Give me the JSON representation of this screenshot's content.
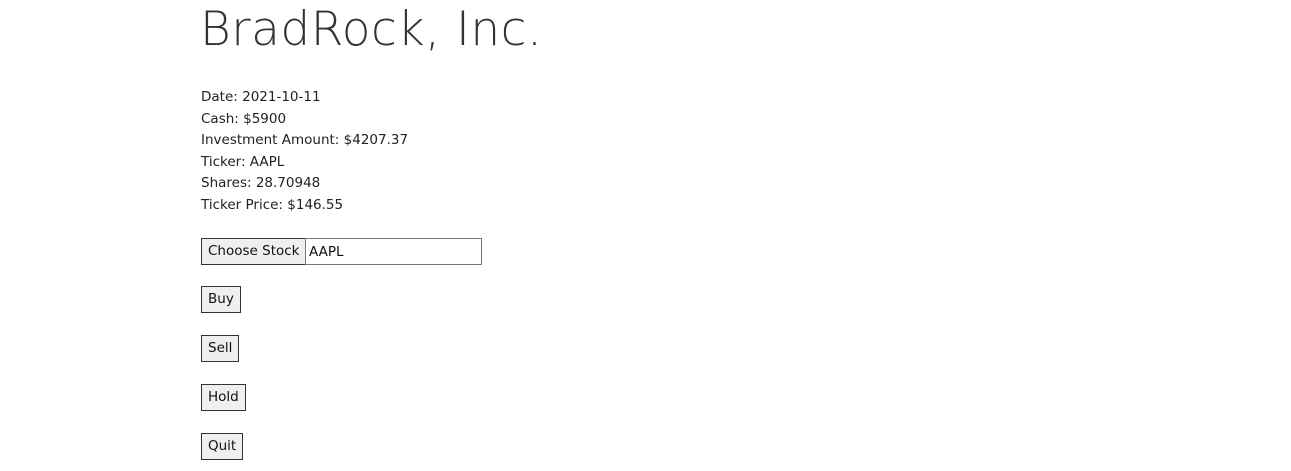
{
  "header": {
    "title": "BradRock, Inc."
  },
  "portfolio": {
    "date_line": "Date: 2021-10-11",
    "cash_line": "Cash: $5900",
    "investment_line": "Investment Amount: $4207.37",
    "ticker_line": "Ticker: AAPL",
    "shares_line": "Shares: 28.70948",
    "price_line": "Ticker Price: $146.55"
  },
  "controls": {
    "choose_stock_label": "Choose Stock",
    "ticker_input_value": "AAPL",
    "buy_label": "Buy",
    "sell_label": "Sell",
    "hold_label": "Hold",
    "quit_label": "Quit"
  }
}
